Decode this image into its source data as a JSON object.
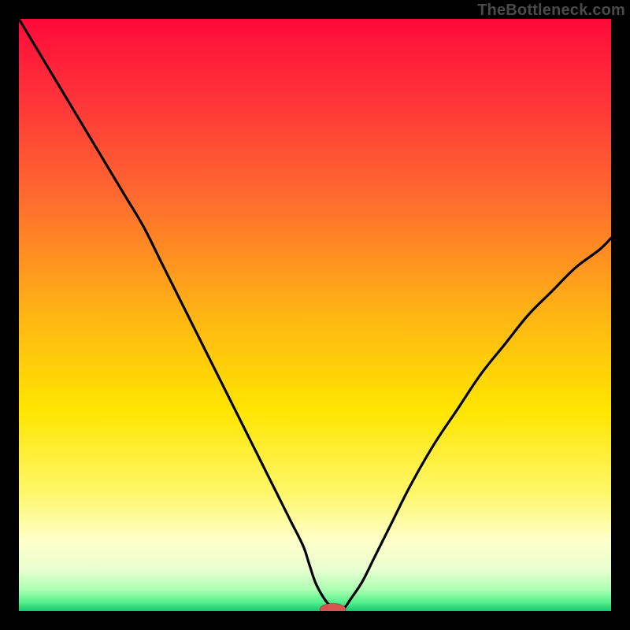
{
  "watermark": "TheBottleneck.com",
  "colors": {
    "frame": "#000000",
    "curve": "#000000",
    "marker_fill": "#d9534f",
    "gradient_stops": [
      {
        "offset": 0.0,
        "color": "#ff0a3a"
      },
      {
        "offset": 0.12,
        "color": "#ff2f3a"
      },
      {
        "offset": 0.3,
        "color": "#ff6a2f"
      },
      {
        "offset": 0.5,
        "color": "#ffb514"
      },
      {
        "offset": 0.66,
        "color": "#ffe500"
      },
      {
        "offset": 0.8,
        "color": "#fff76a"
      },
      {
        "offset": 0.88,
        "color": "#ffffc9"
      },
      {
        "offset": 0.93,
        "color": "#e9ffd0"
      },
      {
        "offset": 0.965,
        "color": "#a8ffb0"
      },
      {
        "offset": 0.985,
        "color": "#55f08c"
      },
      {
        "offset": 1.0,
        "color": "#18c76f"
      }
    ]
  },
  "chart_data": {
    "type": "line",
    "title": "",
    "xlabel": "",
    "ylabel": "",
    "xlim": [
      0,
      100
    ],
    "ylim": [
      0,
      100
    ],
    "grid": false,
    "legend": false,
    "series": [
      {
        "name": "bottleneck-curve",
        "x": [
          0,
          3,
          6,
          9,
          12,
          15,
          18,
          21,
          24,
          26,
          28,
          30,
          32,
          34,
          36,
          38,
          40,
          42,
          44,
          46,
          48,
          49,
          50,
          51,
          52,
          53,
          54,
          55,
          56,
          58,
          60,
          63,
          66,
          70,
          74,
          78,
          82,
          86,
          90,
          94,
          98,
          100
        ],
        "y": [
          100,
          95,
          90,
          85,
          80,
          75,
          70,
          65,
          59,
          55,
          51,
          47,
          43,
          39,
          35,
          31,
          27,
          23,
          19,
          15,
          11,
          8,
          5,
          3,
          1.5,
          0.6,
          0.2,
          0.6,
          2,
          5,
          9,
          15,
          21,
          28,
          34,
          40,
          45,
          50,
          54,
          58,
          61,
          63
        ]
      }
    ],
    "marker": {
      "x": 53,
      "y": 0.3,
      "rx": 2.2,
      "ry": 1.0
    }
  }
}
